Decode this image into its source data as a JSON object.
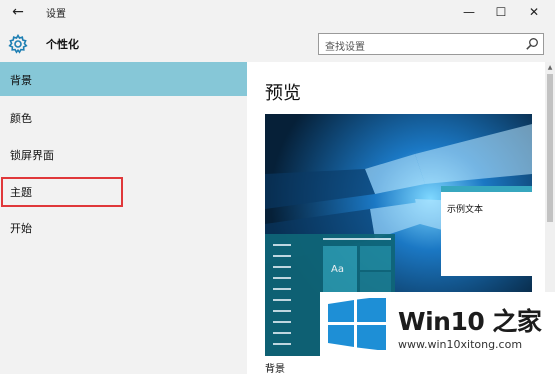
{
  "window": {
    "title": "设置",
    "back_glyph": "←",
    "minimize_glyph": "—",
    "maximize_glyph": "☐",
    "close_glyph": "✕"
  },
  "header": {
    "title": "个性化",
    "icon": "gear-icon"
  },
  "search": {
    "placeholder": "查找设置",
    "icon": "search-icon"
  },
  "sidebar": {
    "items": [
      {
        "label": "背景",
        "selected": true
      },
      {
        "label": "颜色",
        "selected": false
      },
      {
        "label": "锁屏界面",
        "selected": false
      },
      {
        "label": "主题",
        "selected": false,
        "highlighted": true
      },
      {
        "label": "开始",
        "selected": false
      }
    ]
  },
  "main": {
    "preview_title": "预览",
    "sample_text": "示例文本",
    "tile_label": "Aa",
    "background_label": "背景"
  },
  "watermark": {
    "brand": "Win10 之家",
    "url": "www.win10xitong.com"
  },
  "colors": {
    "accent": "#86c7d7",
    "highlight_border": "#e0383a",
    "sidebar_bg": "#f2f2f2",
    "preview_tile": "#2a98ad",
    "logo_blue": "#1e8fd6"
  }
}
